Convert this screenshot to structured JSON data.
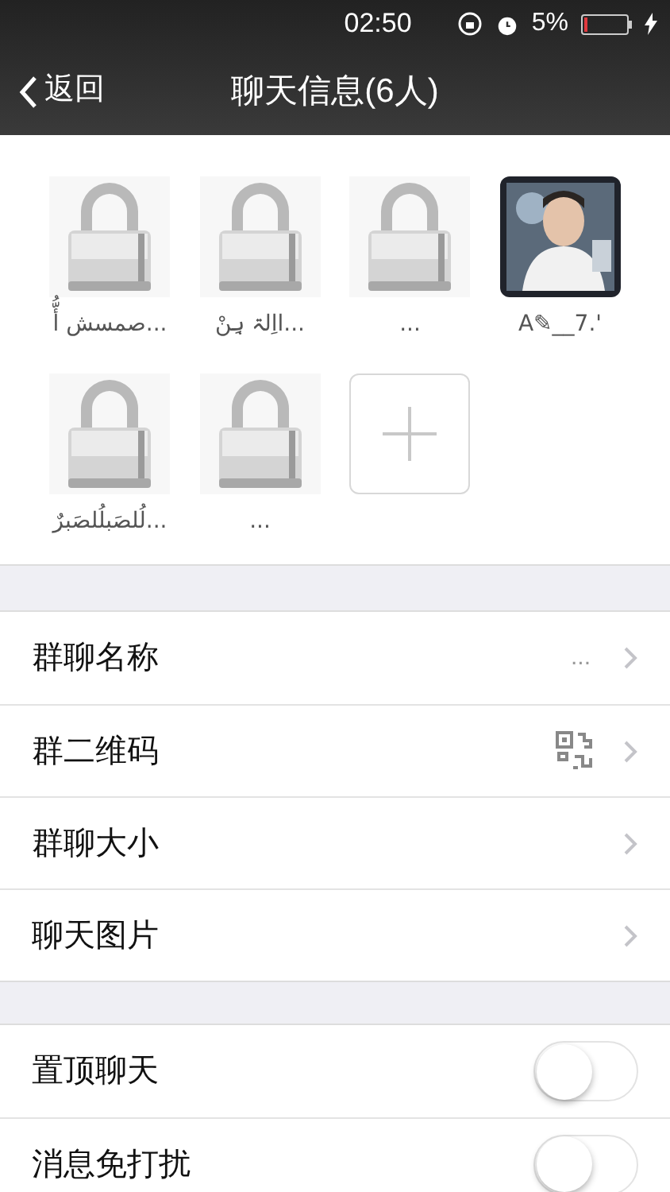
{
  "status_bar": {
    "time": "02:50",
    "battery_text": "5%"
  },
  "nav": {
    "back": "返回",
    "title": "聊天信息(6人)"
  },
  "members": [
    {
      "kind": "lock",
      "name": "صمسش أُّ..."
    },
    {
      "kind": "lock",
      "name": "ااِلۃ ہِنْ..."
    },
    {
      "kind": "lock",
      "name": "..."
    },
    {
      "name": "A✎__7.'"
    },
    {
      "kind": "lock",
      "name": "لُلصَبلُلصَبرٌ..."
    },
    {
      "kind": "lock",
      "name": "..."
    },
    {
      "kind": "add"
    }
  ],
  "settings": [
    {
      "label": "群聊名称",
      "kind": "text",
      "value": "..."
    },
    {
      "label": "群二维码",
      "kind": "qr"
    },
    {
      "label": "群聊大小",
      "kind": "plain"
    },
    {
      "label": "聊天图片",
      "kind": "plain"
    }
  ],
  "toggles": [
    {
      "label": "置顶聊天",
      "on": false
    },
    {
      "label": "消息免打扰",
      "on": false
    }
  ]
}
